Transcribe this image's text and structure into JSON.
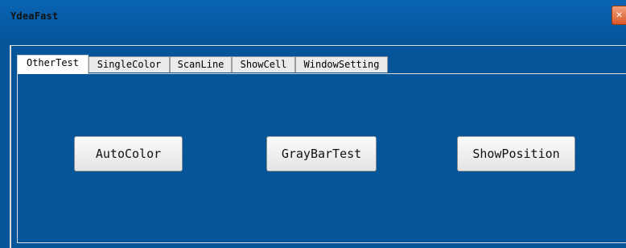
{
  "window": {
    "title": "YdeaFast",
    "close_glyph": "✕"
  },
  "tabs": [
    {
      "label": "OtherTest",
      "active": true
    },
    {
      "label": "SingleColor",
      "active": false
    },
    {
      "label": "ScanLine",
      "active": false
    },
    {
      "label": "ShowCell",
      "active": false
    },
    {
      "label": "WindowSetting",
      "active": false
    }
  ],
  "panel": {
    "buttons": [
      {
        "label": "AutoColor"
      },
      {
        "label": "GrayBarTest"
      },
      {
        "label": "ShowPosition"
      }
    ]
  },
  "colors": {
    "background": "#05559a",
    "tab_inactive": "#ebebeb",
    "button_face": "#efefef",
    "close_button": "#e0673a"
  }
}
